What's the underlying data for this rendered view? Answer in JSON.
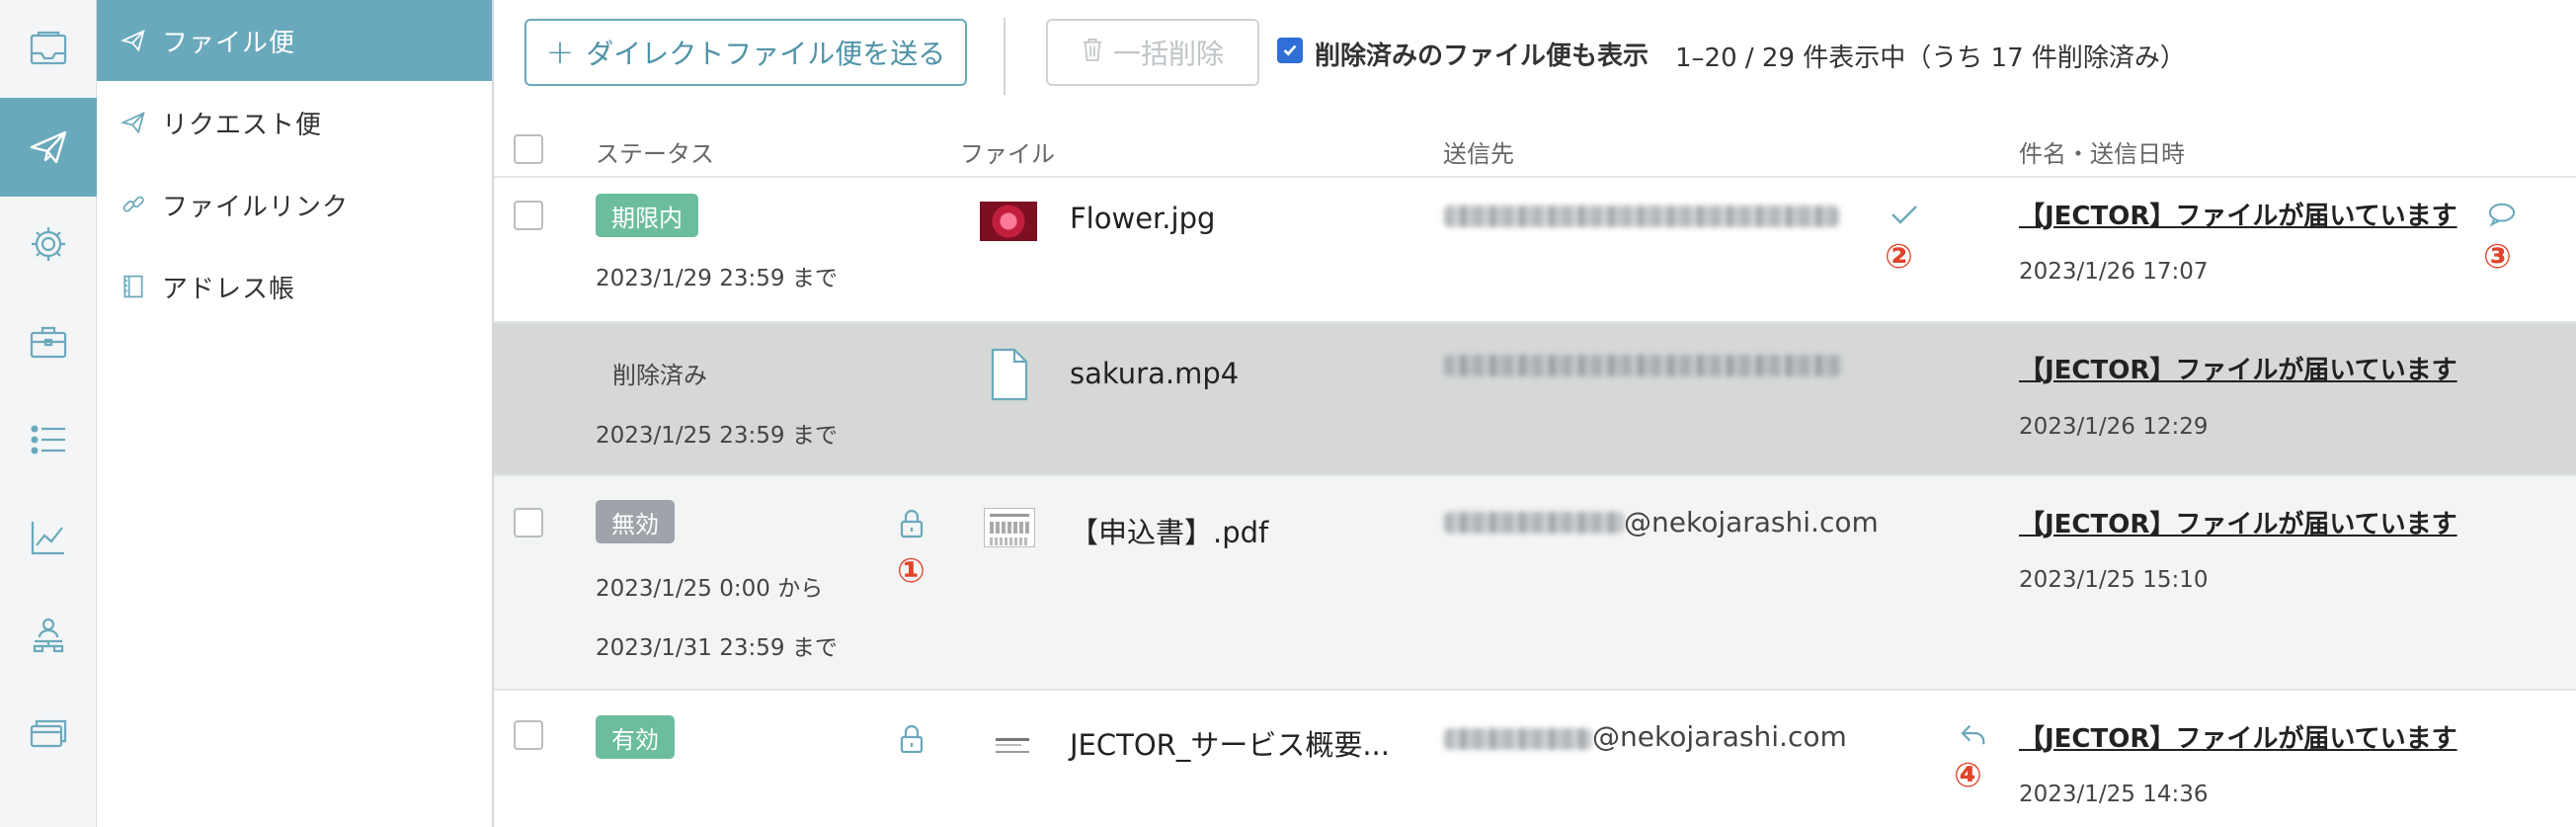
{
  "colors": {
    "accent": "#6aa9bc",
    "badge_green": "#6cbd9e",
    "badge_gray": "#9ea4aa",
    "marker_red": "#e0442a",
    "deleted_row_bg": "#d6d8d8"
  },
  "rail": {
    "items": [
      {
        "icon": "inbox-icon",
        "active": false
      },
      {
        "icon": "paper-plane-icon",
        "active": true
      },
      {
        "icon": "gear-icon",
        "active": false
      },
      {
        "icon": "briefcase-icon",
        "active": false
      },
      {
        "icon": "list-icon",
        "active": false
      },
      {
        "icon": "chart-icon",
        "active": false
      },
      {
        "icon": "org-icon",
        "active": false
      },
      {
        "icon": "cards-icon",
        "active": false
      }
    ]
  },
  "sidebar": {
    "items": [
      {
        "label": "ファイル便",
        "icon": "paper-plane-icon",
        "active": true
      },
      {
        "label": "リクエスト便",
        "icon": "paper-plane-icon",
        "active": false
      },
      {
        "label": "ファイルリンク",
        "icon": "link-icon",
        "active": false
      },
      {
        "label": "アドレス帳",
        "icon": "address-book-icon",
        "active": false
      }
    ]
  },
  "toolbar": {
    "send_button": "ダイレクトファイル便を送る",
    "send_button_icon": "+",
    "bulk_delete_button": "一括削除",
    "show_deleted_checked": true,
    "show_deleted_label": "削除済みのファイル便も表示",
    "count_text": "1–20 / 29 件表示中（うち 17 件削除済み）"
  },
  "table": {
    "headers": {
      "status": "ステータス",
      "file": "ファイル",
      "recipient": "送信先",
      "subject_date": "件名・送信日時"
    },
    "rows": [
      {
        "status_badge": "期限内",
        "status_color": "green",
        "period_lines": [
          "2023/1/29 23:59 まで"
        ],
        "file_name": "Flower.jpg",
        "file_icon": "flower-thumbnail",
        "recipient_domain": "",
        "recipient_icon": "check-icon",
        "recipient_marker": "②",
        "subject": "【JECTOR】ファイルが届いています",
        "sent_at": "2023/1/26 17:07",
        "subject_icon": "comment-icon",
        "subject_marker": "③"
      },
      {
        "status_text": "削除済み",
        "period_lines": [
          "2023/1/25 23:59 まで"
        ],
        "file_name": "sakura.mp4",
        "file_icon": "document-icon",
        "recipient_domain": "",
        "subject": "【JECTOR】ファイルが届いています",
        "sent_at": "2023/1/26 12:29"
      },
      {
        "status_badge": "無効",
        "status_color": "gray",
        "period_lines": [
          "2023/1/25 0:00 から",
          "2023/1/31 23:59 まで"
        ],
        "lock_icon": "lock-icon",
        "lock_marker": "①",
        "file_name": "【申込書】.pdf",
        "file_icon": "pdf-thumbnail",
        "recipient_domain": "@nekojarashi.com",
        "subject": "【JECTOR】ファイルが届いています",
        "sent_at": "2023/1/25 15:10"
      },
      {
        "status_badge": "有効",
        "status_color": "green",
        "period_lines": [],
        "lock_icon": "lock-icon",
        "file_name": "JECTOR_サービス概要...",
        "file_icon": "doc-thumbnail",
        "recipient_domain": "@nekojarashi.com",
        "recipient_icon": "reply-icon",
        "recipient_marker": "④",
        "subject": "【JECTOR】ファイルが届いています",
        "sent_at": "2023/1/25 14:36"
      }
    ]
  }
}
